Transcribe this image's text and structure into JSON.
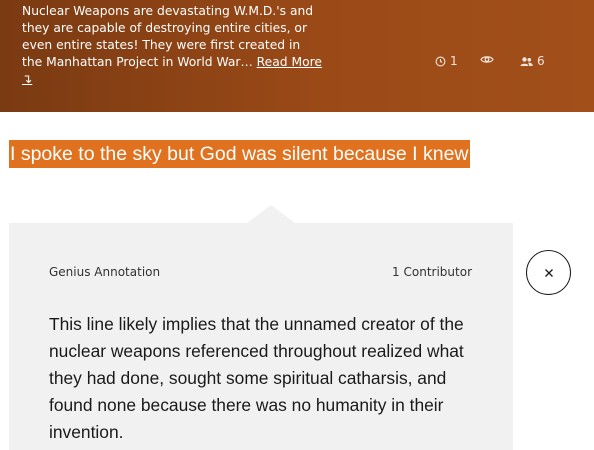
{
  "song_header": {
    "about_text": "Nuclear Weapons are devastating W.M.D.'s and they are capable of destroying entire cities, or even entire states! They were first created in the Manhattan Project in World War…",
    "read_more_label": "Read More ↴",
    "stats": {
      "clock_icon": "clock-icon",
      "clock_count": "1",
      "views_icon": "eye-icon",
      "views_count": "",
      "contributors_icon": "people-icon",
      "contributors_count": "6"
    }
  },
  "lyric": {
    "line": "I spoke to the sky but God was silent because I knew"
  },
  "annotation": {
    "label": "Genius Annotation",
    "contributors": "1 Contributor",
    "body": "This line likely implies that the unnamed creator of the nuclear weapons referenced throughout realized what they had done, sought some spiritual catharsis, and found none because there was no humanity in their invention.",
    "close_icon": "close-icon"
  },
  "colors": {
    "header_bg": "#9b4a17",
    "highlight": "#e0711f",
    "card_bg": "#f1f1f1"
  }
}
